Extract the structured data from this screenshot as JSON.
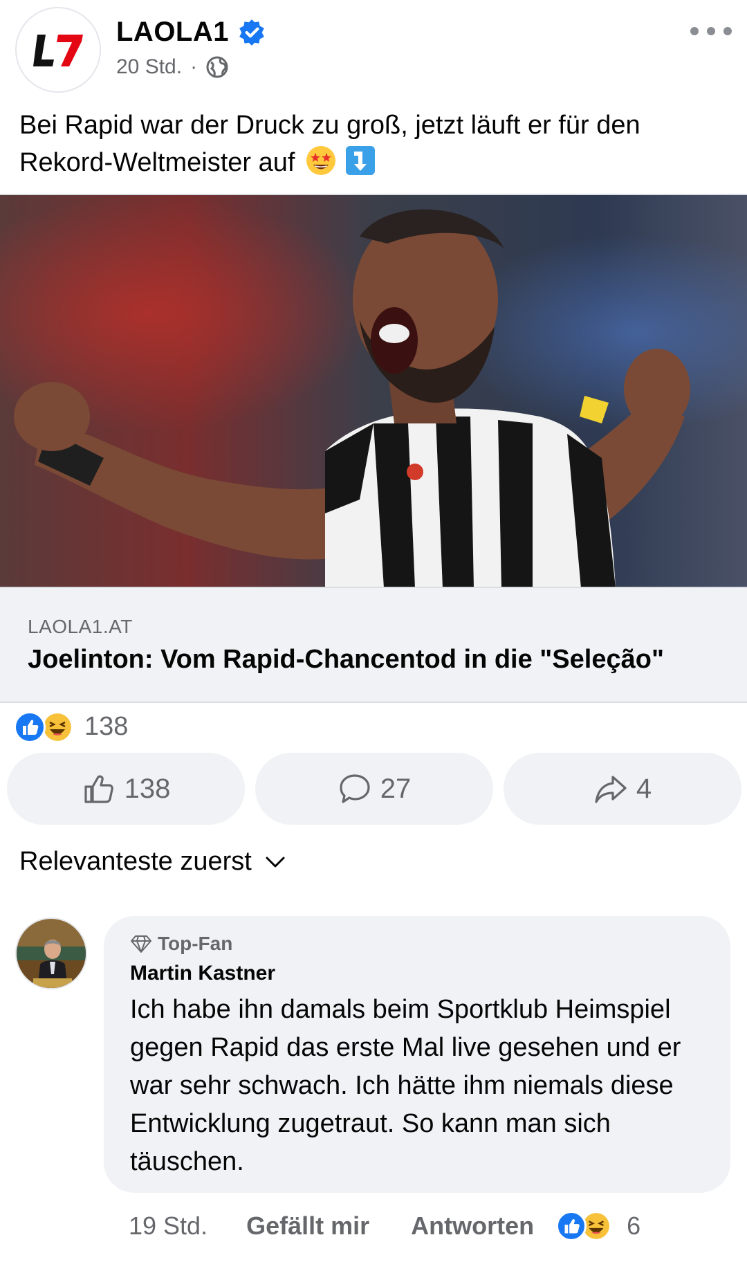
{
  "post": {
    "page_name": "LAOLA1",
    "time": "20 Std.",
    "separator": "·",
    "logo_text": "L7",
    "text_line1": "Bei Rapid war der Druck zu groß, jetzt läuft er für den",
    "text_line2": "Rekord-Weltmeister auf"
  },
  "link": {
    "domain": "LAOLA1.AT",
    "title": "Joelinton: Vom Rapid-Chancentod in die \"Seleção\""
  },
  "reactions": {
    "count": "138"
  },
  "actions": {
    "like_count": "138",
    "comment_count": "27",
    "share_count": "4"
  },
  "sort": {
    "label": "Relevanteste zuerst"
  },
  "comment": {
    "badge": "Top-Fan",
    "author": "Martin Kastner",
    "text": "Ich habe ihn damals beim Sportklub Heimspiel gegen Rapid das erste Mal live gesehen und er war sehr schwach. Ich hätte ihm niemals diese Entwicklung zugetraut. So kann man sich täuschen.",
    "time": "19 Std.",
    "like_label": "Gefällt mir",
    "reply_label": "Antworten",
    "reaction_count": "6"
  },
  "icons": {
    "verified": "verified-badge-icon",
    "globe": "globe-icon",
    "more": "more-options-icon",
    "like": "thumbs-up-icon",
    "comment": "comment-icon",
    "share": "share-arrow-icon",
    "sort": "chevron-down-icon",
    "topfan": "diamond-icon"
  },
  "colors": {
    "brand_blue": "#1877f2",
    "logo_red": "#e30613",
    "secondary_text": "#65676b",
    "button_bg": "#f0f2f5"
  }
}
